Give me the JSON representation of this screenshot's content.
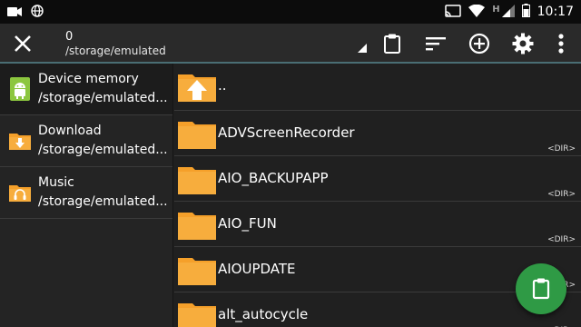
{
  "status_bar": {
    "time": "10:17",
    "left_icons": [
      "video-camera-icon",
      "globe-icon"
    ],
    "right_icons": [
      "cast-icon",
      "wifi-icon",
      "signal-icon",
      "battery-icon"
    ],
    "network_label": "H"
  },
  "toolbar": {
    "close_icon": "close-icon",
    "count": "0",
    "path": "/storage/emulated",
    "actions": [
      "clipboard-icon",
      "sort-icon",
      "add-circle-icon",
      "gear-icon",
      "more-vert-icon"
    ]
  },
  "sidebar": {
    "items": [
      {
        "title": "Device memory",
        "subtitle": "/storage/emulated...",
        "icon": "android-icon"
      },
      {
        "title": "Download",
        "subtitle": "/storage/emulated...",
        "icon": "download-folder-icon"
      },
      {
        "title": "Music",
        "subtitle": "/storage/emulated...",
        "icon": "music-folder-icon"
      }
    ]
  },
  "files": {
    "up_label": "..",
    "items": [
      {
        "name": "ADVScreenRecorder",
        "type": "<DIR>"
      },
      {
        "name": "AIO_BACKUPAPP",
        "type": "<DIR>"
      },
      {
        "name": "AIO_FUN",
        "type": "<DIR>"
      },
      {
        "name": "AIOUPDATE",
        "type": "<DIR>"
      },
      {
        "name": "alt_autocycle",
        "type": "<DIR>"
      }
    ]
  },
  "fab": {
    "icon": "paste-clipboard-icon"
  },
  "colors": {
    "folder": "#f5a02a",
    "accent_line": "#4a6e74",
    "fab": "#2f9a45",
    "android_green": "#8cc63f"
  }
}
